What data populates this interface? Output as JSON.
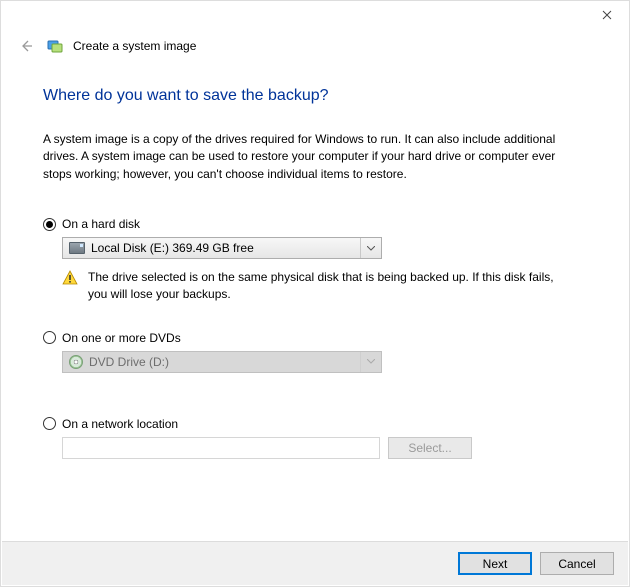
{
  "window": {
    "title": "Create a system image"
  },
  "page": {
    "heading": "Where do you want to save the backup?",
    "intro": "A system image is a copy of the drives required for Windows to run. It can also include additional drives. A system image can be used to restore your computer if your hard drive or computer ever stops working; however, you can't choose individual items to restore."
  },
  "options": {
    "hard_disk": {
      "label": "On a hard disk",
      "selected_drive": "Local Disk (E:)  369.49 GB free",
      "warning": "The drive selected is on the same physical disk that is being backed up. If this disk fails, you will lose your backups."
    },
    "dvd": {
      "label": "On one or more DVDs",
      "selected_drive": " DVD Drive (D:)"
    },
    "network": {
      "label": "On a network location",
      "path": "",
      "select_label": "Select..."
    }
  },
  "footer": {
    "next": "Next",
    "cancel": "Cancel"
  }
}
